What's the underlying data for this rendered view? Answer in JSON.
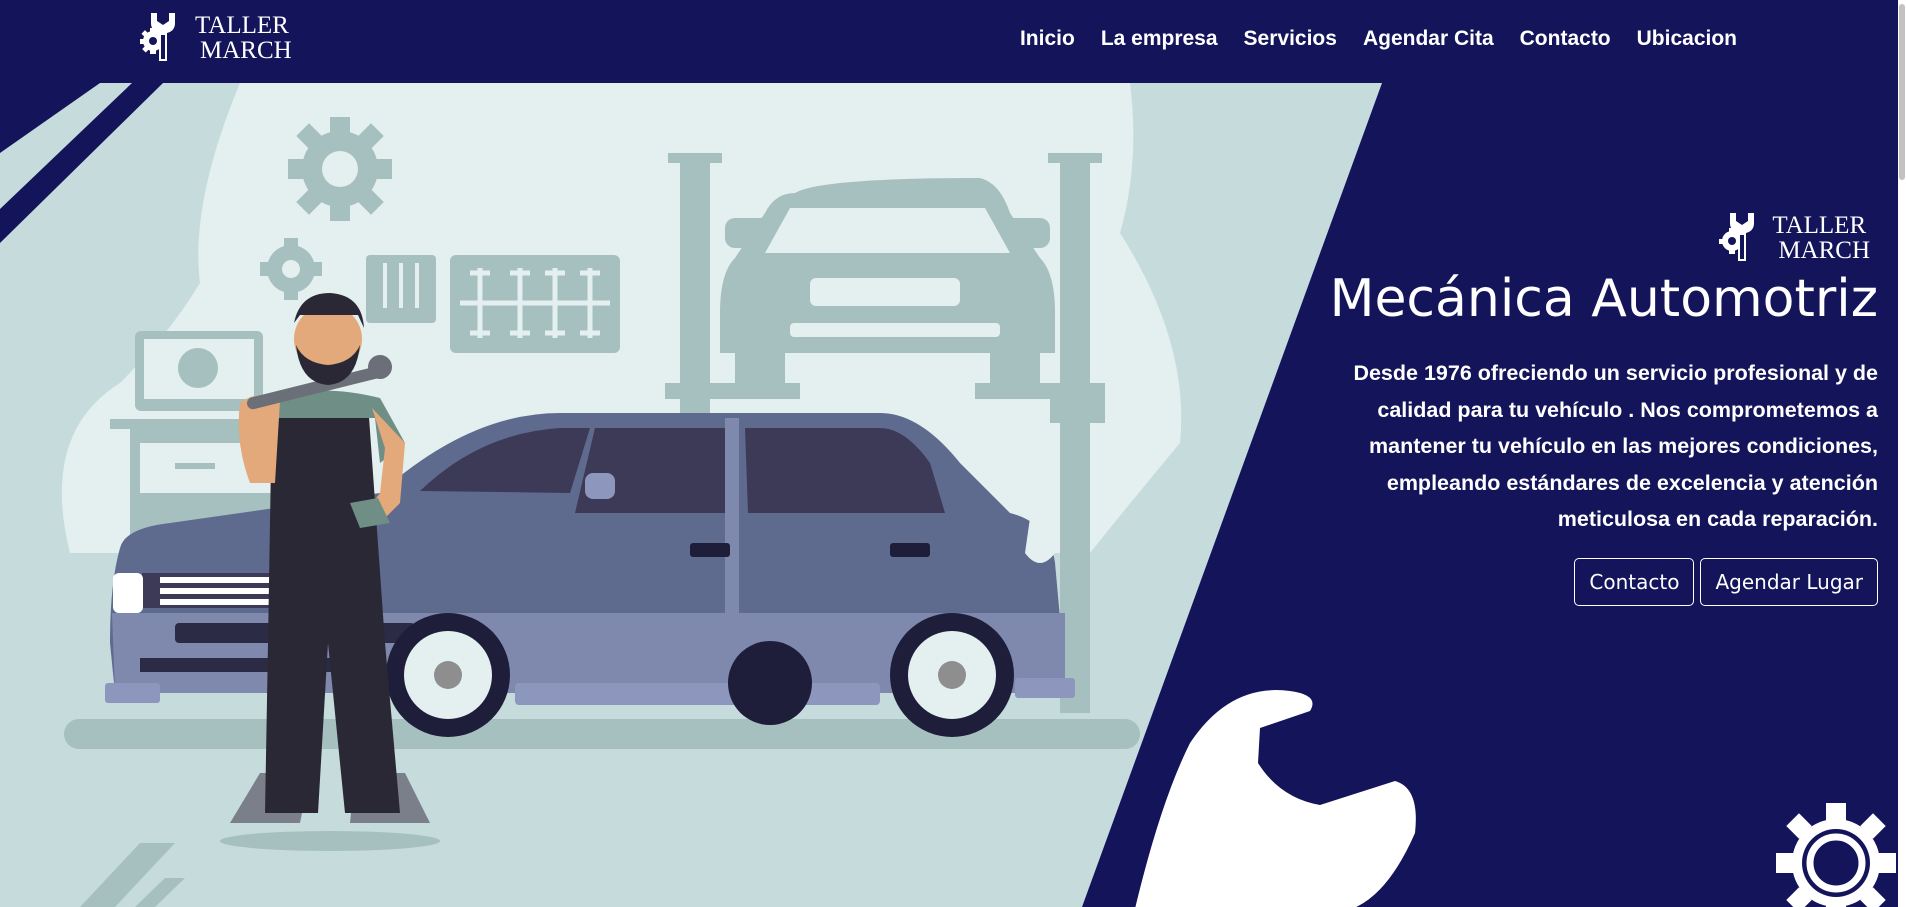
{
  "nav": {
    "brand_line1": "TALLER",
    "brand_line2": "MARCH",
    "links": [
      "Inicio",
      "La empresa",
      "Servicios",
      "Agendar Cita",
      "Contacto",
      "Ubicacion"
    ]
  },
  "hero": {
    "brand_line1": "TALLER",
    "brand_line2": "MARCH",
    "title": "Mecánica Automotriz",
    "description": "Desde 1976 ofreciendo un servicio profesional y de calidad para tu vehículo . Nos comprometemos a mantener tu vehículo en las mejores condiciones, empleando estándares de excelencia y atención meticulosa en cada reparación.",
    "buttons": [
      "Contacto",
      "Agendar Lugar"
    ]
  },
  "colors": {
    "navy": "#14145a",
    "light_panel": "#e4efef",
    "mid_panel": "#c6dcdc",
    "equipment": "#a6bfbf",
    "car_body": "#5f6a8f"
  },
  "icons": [
    "wrench-gear-logo-icon",
    "gear-icon",
    "wrench-icon"
  ]
}
